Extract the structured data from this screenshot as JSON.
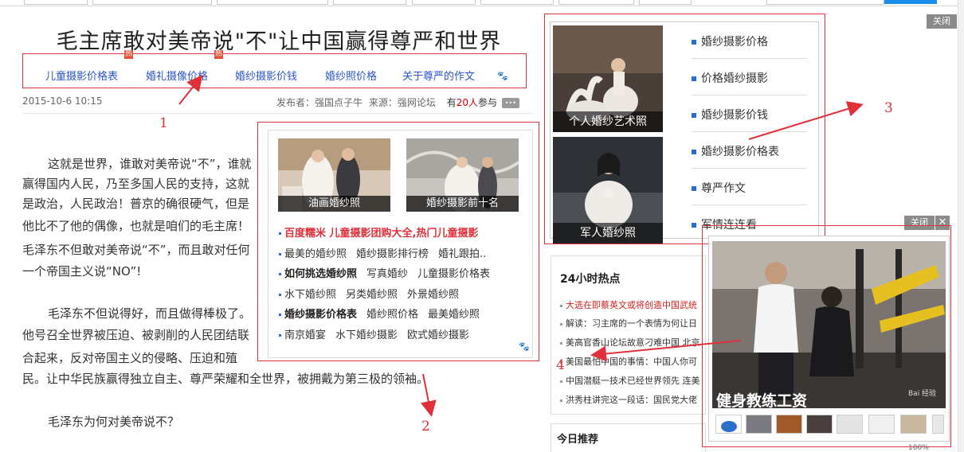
{
  "title": "毛主席敢对美帝说\"不\"让中国赢得尊严和世界",
  "keyword_links": [
    {
      "label": "儿童摄影价格表",
      "hot": "热"
    },
    {
      "label": "婚礼摄像价格",
      "hot": "热"
    },
    {
      "label": "婚纱摄影价钱",
      "hot": ""
    },
    {
      "label": "婚纱照价格",
      "hot": ""
    },
    {
      "label": "关于尊严的作文",
      "hot": ""
    }
  ],
  "meta": {
    "date": "2015-10-6 10:15",
    "publisher": "发布者：强国点子牛",
    "source": "来源：强网论坛",
    "participants_prefix": "有",
    "participants_count": "20人",
    "participants_suffix": "参与"
  },
  "article": {
    "lines": [
      "这就是世界，谁敢对美帝说“不”，谁就",
      "赢得国内人民，乃至多国人民的支持，这就",
      "是政治，人民政治！普京的确很硬气，但是",
      "他比不了他的偶像，也就是咱们的毛主席！",
      "毛泽东不但敢对美帝说“不”，而且敢对任何",
      "一个帝国主义说“NO”!",
      "毛泽东不但说得好，而且做得棒极了。",
      "他号召全世界被压迫、被剥削的人民团结联",
      "合起来，反对帝国主义的侵略、压迫和殖",
      "民。让中华民族赢得独立自主、尊严荣耀和全世界，被拥戴为第三极的领袖。",
      "毛泽东为何对美帝说不？"
    ]
  },
  "annotations": [
    "1",
    "2",
    "3",
    "4"
  ],
  "ad2": {
    "thumbs": [
      "油画婚纱照",
      "婚纱摄影前十名"
    ],
    "lines": [
      [
        {
          "t": "百度糯米 儿童摄影团购大全,热门儿童摄影",
          "s": "red"
        }
      ],
      [
        {
          "t": "最美的婚纱照",
          "s": ""
        },
        {
          "t": "婚纱摄影排行榜",
          "s": ""
        },
        {
          "t": "婚礼跟拍..",
          "s": ""
        }
      ],
      [
        {
          "t": "如何挑选婚纱照",
          "s": "b"
        },
        {
          "t": "写真婚纱",
          "s": ""
        },
        {
          "t": "儿童摄影价格表",
          "s": ""
        }
      ],
      [
        {
          "t": "水下婚纱照",
          "s": ""
        },
        {
          "t": "另类婚纱照",
          "s": ""
        },
        {
          "t": "外景婚纱照",
          "s": ""
        }
      ],
      [
        {
          "t": "婚纱摄影价格表",
          "s": "b"
        },
        {
          "t": "婚纱照价格",
          "s": ""
        },
        {
          "t": "最美婚纱照",
          "s": ""
        }
      ],
      [
        {
          "t": "南京婚宴",
          "s": ""
        },
        {
          "t": "水下婚纱摄影",
          "s": ""
        },
        {
          "t": "欧式婚纱摄影",
          "s": ""
        }
      ]
    ]
  },
  "ad3": {
    "pics": [
      "个人婚纱艺术照",
      "军人婚纱照"
    ],
    "items": [
      "婚纱摄影价格",
      "价格婚纱摄影",
      "婚纱摄影价钱",
      "婚纱摄影价格表",
      "尊严作文",
      "军情连连看"
    ]
  },
  "close_label": "关闭",
  "close_x": "✕",
  "hot24": {
    "heading": "24小时热点",
    "items": [
      {
        "text": "大选在即蔡英文或将创造中国武统",
        "red": true
      },
      {
        "text": "解读：习主席的一个表情为何让日",
        "red": false
      },
      {
        "text": "美高官香山论坛故意刁难中国 北京",
        "red": false
      },
      {
        "text": "美国最怕中国的事情：中国人你可",
        "red": false
      },
      {
        "text": "中国潜艇一技术已经世界领先 连美",
        "red": false
      },
      {
        "text": "洪秀柱讲完这一段话：国民党大佬",
        "red": false
      }
    ]
  },
  "today_heading": "今日推荐",
  "ad4": {
    "caption": "健身教练工资",
    "watermark": "Bai 经验"
  },
  "statusbar": "100%",
  "colors": {
    "accent_red": "#e0303a",
    "link_blue": "#2a55c8",
    "bullet_blue": "#2a6dcc"
  }
}
